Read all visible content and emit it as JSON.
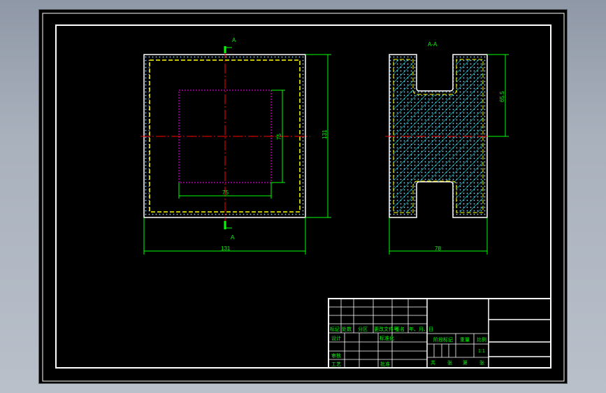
{
  "drawing": {
    "front_view": {
      "dim_width": "131",
      "dim_height": "131",
      "dim_inner_height": "75",
      "dim_inner_width": "75",
      "section_marker_top": "A",
      "section_marker_bottom": "A"
    },
    "section_view": {
      "title": "A-A",
      "dim_width": "78",
      "dim_depth": "65.5"
    },
    "title_block": {
      "rev_headers": [
        "标记",
        "处数",
        "分区",
        "更改文件号",
        "签名",
        "年、月、日"
      ],
      "design": "设计",
      "standardization": "标准化",
      "review": "审核",
      "process": "工艺",
      "approve": "批准",
      "stage_mark": "阶段标记",
      "weight": "重量",
      "scale": "比例",
      "scale_value": "1:1",
      "sheets_total": "共",
      "sheets_unit": "张",
      "sheet_no": "第",
      "sheet_unit2": "张"
    }
  },
  "colors": {
    "background": "#000000",
    "frame": "#ffffff",
    "dimension": "#00ff00",
    "centerline": "#ff0000",
    "hidden": "#ff00ff",
    "outline": "#ffff00",
    "hatch": "#00ffff"
  }
}
